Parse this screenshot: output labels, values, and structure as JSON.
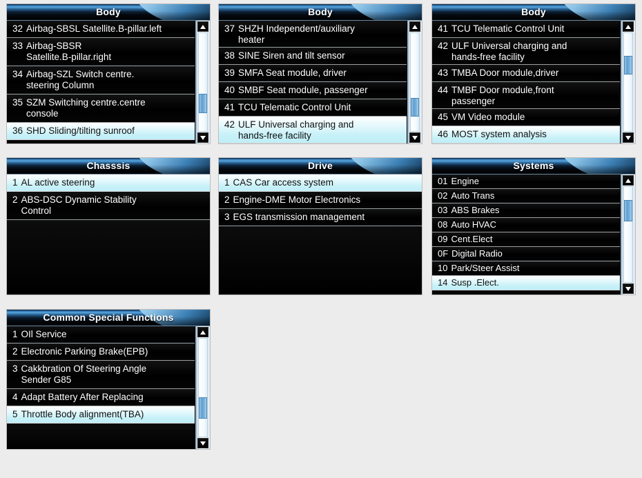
{
  "background_color": "#ececec",
  "colors": {
    "panel_bg": "#000000",
    "row_text": "#ffffff",
    "selected_row_bg": "#c8f1f8",
    "selected_row_text": "#101010",
    "header_accent": "#58a6de",
    "scrollbar_thumb": "#5f9fd0",
    "row_divider": "#9aa0a4"
  },
  "scroll_icons": {
    "up": "scroll-up-arrow-icon",
    "down": "scroll-down-arrow-icon"
  },
  "panels": [
    {
      "id": "body1",
      "title": "Body",
      "has_scrollbar": true,
      "scroll": {
        "thumb_top_pct": 62,
        "thumb_height_pct": 20
      },
      "rows": [
        {
          "num": "32",
          "label": "Airbag-SBSL Satellite.B-pillar.left",
          "selected": false
        },
        {
          "num": "33",
          "label": "Airbag-SBSR\nSatellite.B-pillar.right",
          "selected": false
        },
        {
          "num": "34",
          "label": "Airbag-SZL Switch centre.\nsteering Column",
          "selected": false
        },
        {
          "num": "35",
          "label": "SZM Switching centre.centre\nconsole",
          "selected": false
        },
        {
          "num": "36",
          "label": "SHD Sliding/tilting sunroof",
          "selected": true
        }
      ]
    },
    {
      "id": "body2",
      "title": "Body",
      "has_scrollbar": true,
      "scroll": {
        "thumb_top_pct": 66,
        "thumb_height_pct": 19
      },
      "rows": [
        {
          "num": "37",
          "label": "SHZH Independent/auxiliary\nheater",
          "selected": false
        },
        {
          "num": "38",
          "label": "SINE Siren and tilt sensor",
          "selected": false
        },
        {
          "num": "39",
          "label": "SMFA  Seat module, driver",
          "selected": false
        },
        {
          "num": "40",
          "label": "SMBF  Seat module, passenger",
          "selected": false
        },
        {
          "num": "41",
          "label": "TCU Telematic Control Unit",
          "selected": false
        },
        {
          "num": "42",
          "label": "ULF Universal charging and\n     hands-free facility",
          "selected": true
        }
      ]
    },
    {
      "id": "body3",
      "title": "Body",
      "has_scrollbar": true,
      "scroll": {
        "thumb_top_pct": 23,
        "thumb_height_pct": 19
      },
      "rows": [
        {
          "num": "41",
          "label": "TCU Telematic Control Unit",
          "selected": false
        },
        {
          "num": "42",
          "label": "ULF  Universal charging and\n      hands-free facility",
          "selected": false
        },
        {
          "num": "43",
          "label": "TMBA Door module,driver",
          "selected": false
        },
        {
          "num": "44",
          "label": "TMBF  Door module,front\n      passenger",
          "selected": false
        },
        {
          "num": "45",
          "label": "VM Video module",
          "selected": false
        },
        {
          "num": "46",
          "label": "MOST system analysis",
          "selected": true
        }
      ]
    },
    {
      "id": "chassis",
      "title": "Chasssis",
      "has_scrollbar": false,
      "rows": [
        {
          "num": "1",
          "label": "AL active steering",
          "selected": true
        },
        {
          "num": "2",
          "label": "ABS-DSC Dynamic Stability\nControl",
          "selected": false
        }
      ]
    },
    {
      "id": "drive",
      "title": "Drive",
      "has_scrollbar": false,
      "rows": [
        {
          "num": "1",
          "label": "CAS Car access system",
          "selected": true
        },
        {
          "num": "2",
          "label": "Engine-DME Motor Electronics",
          "selected": false
        },
        {
          "num": "3",
          "label": "EGS transmission management",
          "selected": false
        }
      ]
    },
    {
      "id": "systems",
      "title": "Systems",
      "has_scrollbar": true,
      "compact": true,
      "scroll": {
        "thumb_top_pct": 14,
        "thumb_height_pct": 22
      },
      "rows": [
        {
          "num": "01",
          "label": "Engine",
          "selected": false
        },
        {
          "num": "02",
          "label": "Auto Trans",
          "selected": false
        },
        {
          "num": "03",
          "label": "ABS Brakes",
          "selected": false
        },
        {
          "num": "08",
          "label": "Auto HVAC",
          "selected": false
        },
        {
          "num": "09",
          "label": "Cent.Elect",
          "selected": false
        },
        {
          "num": "0F",
          "label": " Digital Radio",
          "selected": false
        },
        {
          "num": "10",
          "label": " Park/Steer Assist",
          "selected": false
        },
        {
          "num": "14",
          "label": "Susp .Elect.",
          "selected": true
        }
      ]
    },
    {
      "id": "common",
      "title": "Common Special Functions",
      "has_scrollbar": true,
      "scroll": {
        "thumb_top_pct": 60,
        "thumb_height_pct": 22
      },
      "rows": [
        {
          "num": "1",
          "label": "OIl Service",
          "selected": false
        },
        {
          "num": "2",
          "label": "Electronic Parking Brake(EPB)",
          "selected": false
        },
        {
          "num": "3",
          "label": "Cakkbration Of Steering Angle\nSender G85",
          "selected": false
        },
        {
          "num": "4",
          "label": "Adapt Battery After Replacing",
          "selected": false
        },
        {
          "num": "5",
          "label": "Throttle Body alignment(TBA)",
          "selected": true
        }
      ]
    }
  ]
}
